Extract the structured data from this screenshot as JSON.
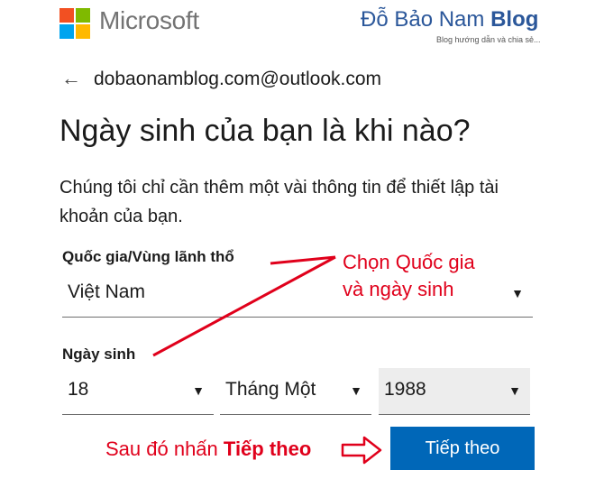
{
  "header": {
    "brand_name": "Microsoft",
    "logo_colors": [
      "#f25022",
      "#7fba00",
      "#00a4ef",
      "#ffb900"
    ],
    "blog_title_regular": "Đỗ Bảo Nam ",
    "blog_title_bold": "Blog",
    "blog_tagline": "Blog hướng dẫn và chia sẻ..."
  },
  "identity": {
    "back_icon": "←",
    "email": "dobaonamblog.com@outlook.com"
  },
  "form": {
    "heading": "Ngày sinh của bạn là khi nào?",
    "description": "Chúng tôi chỉ cần thêm một vài thông tin để thiết lập tài khoản của bạn.",
    "country_label": "Quốc gia/Vùng lãnh thổ",
    "country_value": "Việt Nam",
    "birthdate_label": "Ngày sinh",
    "day_value": "18",
    "month_value": "Tháng Một",
    "year_value": "1988",
    "dropdown_icon": "▼",
    "next_button": "Tiếp theo",
    "accent_color": "#0067b8"
  },
  "annotations": {
    "line1": "Chọn Quốc gia",
    "line2": "và ngày sinh",
    "bottom_prefix": "Sau đó nhấn ",
    "bottom_bold": "Tiếp theo",
    "color": "#e0001b"
  }
}
